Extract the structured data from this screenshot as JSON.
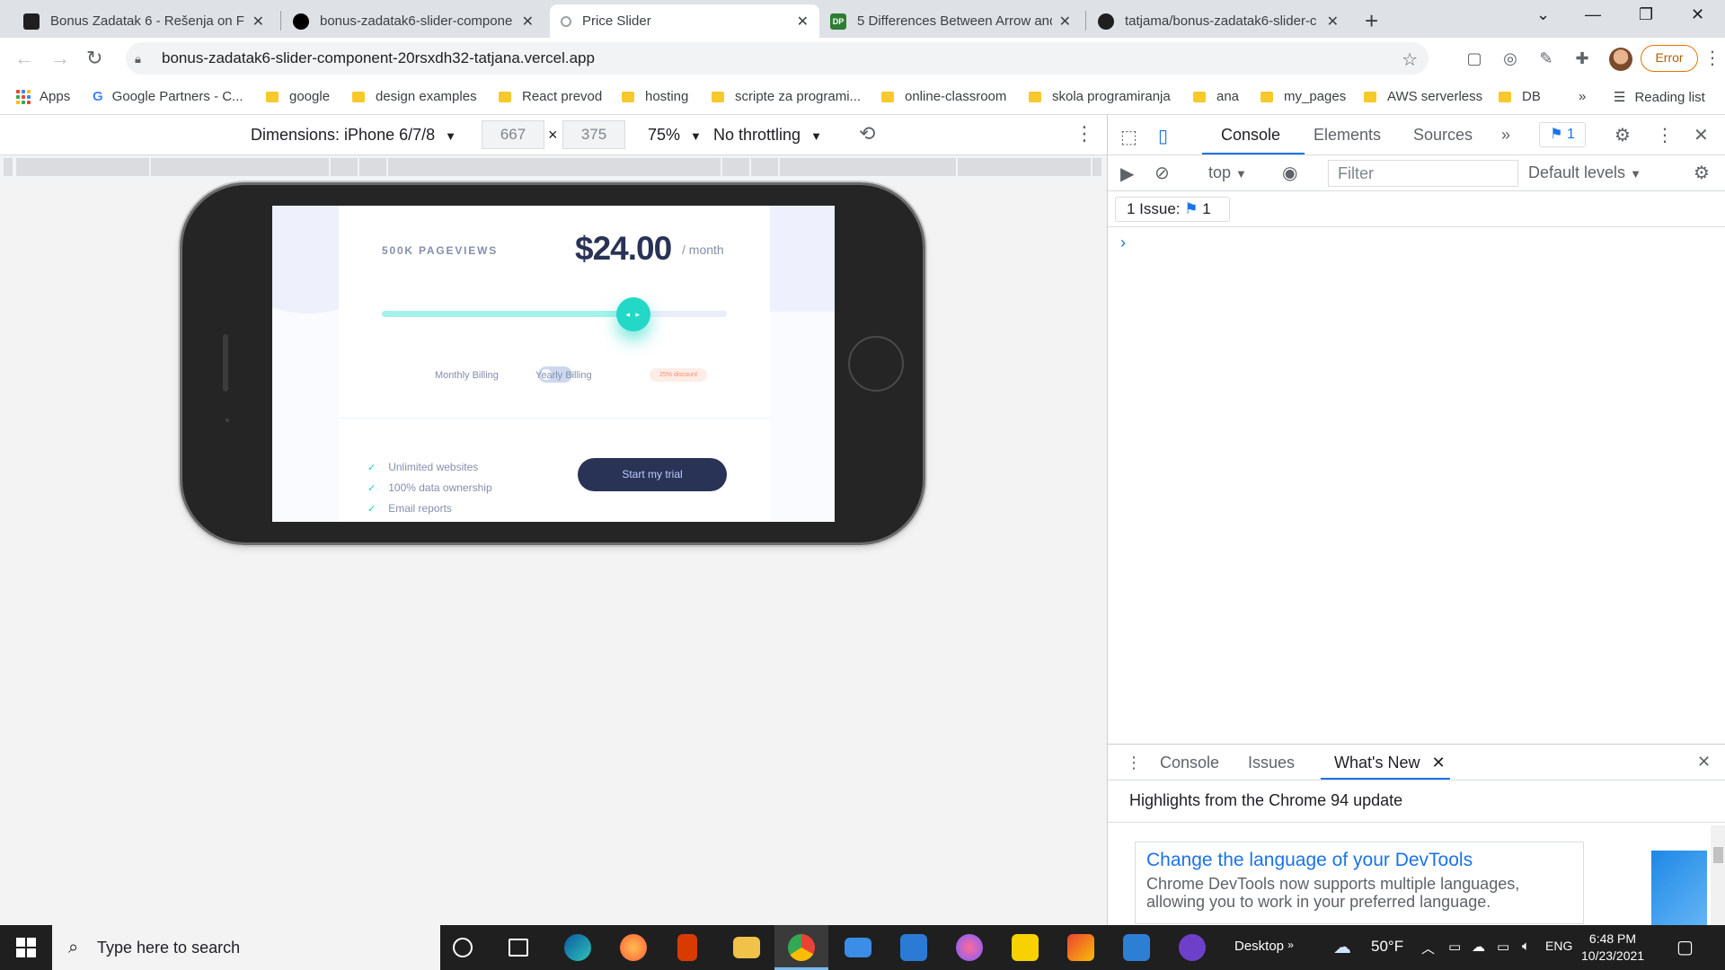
{
  "browser": {
    "tabs": [
      {
        "title": "Bonus Zadatak 6 - Rešenja on FE",
        "active": false,
        "favicon_color": "#1f1f1f"
      },
      {
        "title": "bonus-zadatak6-slider-compone",
        "active": false,
        "favicon_color": "#000000"
      },
      {
        "title": "Price Slider",
        "active": true,
        "favicon_color": "#9aa0a6"
      },
      {
        "title": "5 Differences Between Arrow and",
        "active": false,
        "favicon_color": "#2e7d32"
      },
      {
        "title": "tatjama/bonus-zadatak6-slider-c",
        "active": false,
        "favicon_color": "#1f1f1f"
      }
    ],
    "tab_close_glyph": "✕",
    "new_tab_glyph": "+",
    "window_controls": {
      "tabsearch": "⌄",
      "minimize": "—",
      "restore": "❐",
      "close": "✕"
    },
    "url": "bonus-zadatak6-slider-component-20rsxdh32-tatjana.vercel.app",
    "error_label": "Error",
    "bookmarks": [
      {
        "label": "Apps",
        "icon": "apps-grid-icon"
      },
      {
        "label": "Google Partners - C...",
        "icon": "google-icon"
      },
      {
        "label": "google",
        "icon": "folder-icon"
      },
      {
        "label": "design examples",
        "icon": "folder-icon"
      },
      {
        "label": "React prevod",
        "icon": "folder-icon"
      },
      {
        "label": "hosting",
        "icon": "folder-icon"
      },
      {
        "label": "scripte za programi...",
        "icon": "folder-icon"
      },
      {
        "label": "online-classroom",
        "icon": "folder-icon"
      },
      {
        "label": "skola programiranja",
        "icon": "folder-icon"
      },
      {
        "label": "ana",
        "icon": "folder-icon"
      },
      {
        "label": "my_pages",
        "icon": "folder-icon"
      },
      {
        "label": "AWS serverless",
        "icon": "folder-icon"
      },
      {
        "label": "DB",
        "icon": "folder-icon"
      }
    ],
    "bookmarks_overflow": "»",
    "reading_list": "Reading list"
  },
  "device_toolbar": {
    "dimensions_label": "Dimensions: iPhone 6/7/8",
    "width": "667",
    "height": "375",
    "times": "×",
    "zoom": "75%",
    "throttling": "No throttling"
  },
  "app": {
    "pageviews": "500K PAGEVIEWS",
    "price": "$24.00",
    "per": "/ month",
    "slider_fraction": 0.73,
    "thumb_glyph": "◂ ▸",
    "monthly": "Monthly Billing",
    "yearly": "Yearly Billing",
    "discount": "25% discount",
    "features": [
      "Unlimited websites",
      "100% data ownership",
      "Email reports"
    ],
    "check_glyph": "✓",
    "cta": "Start my trial"
  },
  "devtools": {
    "tabs": [
      "Console",
      "Elements",
      "Sources"
    ],
    "more_tabs": "»",
    "issues_badge": "1",
    "context": "top",
    "filter_placeholder": "Filter",
    "levels": "Default levels",
    "issue_label": "1 Issue:",
    "issue_count": "1",
    "prompt": "›",
    "drawer_tabs": [
      "Console",
      "Issues",
      "What's New"
    ],
    "highlights": "Highlights from the Chrome 94 update",
    "card_title": "Change the language of your DevTools",
    "card_body": "Chrome DevTools now supports multiple languages, allowing you to work in your preferred language."
  },
  "taskbar": {
    "search_placeholder": "Type here to search",
    "desktop": "Desktop",
    "temperature": "50°F",
    "language": "ENG",
    "time": "6:48 PM",
    "date": "10/23/2021"
  }
}
